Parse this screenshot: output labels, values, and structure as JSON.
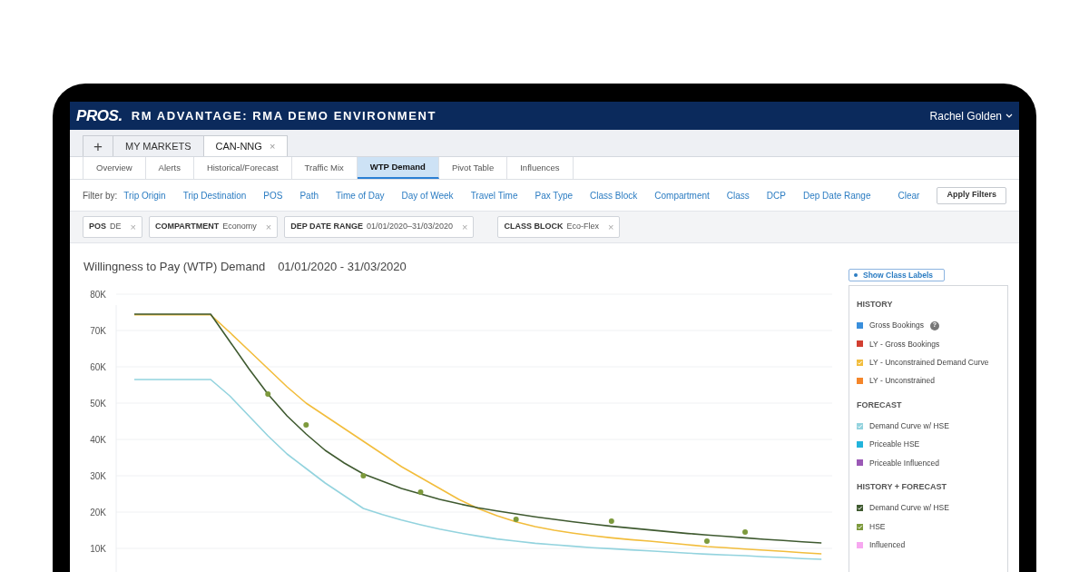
{
  "header": {
    "logo": "PROS.",
    "title": "RM ADVANTAGE: RMA DEMO ENVIRONMENT",
    "user": "Rachel Golden"
  },
  "workspace_tabs": {
    "add": "+",
    "tabs": [
      {
        "label": "MY MARKETS",
        "selected": false
      },
      {
        "label": "CAN-NNG",
        "selected": true,
        "close": "×"
      }
    ]
  },
  "view_tabs": [
    {
      "label": "Overview",
      "selected": false
    },
    {
      "label": "Alerts",
      "selected": false
    },
    {
      "label": "Historical/Forecast",
      "selected": false
    },
    {
      "label": "Traffic Mix",
      "selected": false
    },
    {
      "label": "WTP Demand",
      "selected": true
    },
    {
      "label": "Pivot Table",
      "selected": false
    },
    {
      "label": "Influences",
      "selected": false
    }
  ],
  "filter_bar": {
    "label": "Filter by:",
    "filters": [
      "Trip Origin",
      "Trip Destination",
      "POS",
      "Path",
      "Time of Day",
      "Day of Week",
      "Travel Time",
      "Pax Type",
      "Class Block",
      "Compartment",
      "Class",
      "DCP",
      "Dep Date Range"
    ],
    "clear": "Clear",
    "apply": "Apply Filters"
  },
  "active_filters": [
    {
      "name": "POS",
      "value": "DE",
      "remove": "×"
    },
    {
      "name": "COMPARTMENT",
      "value": "Economy",
      "remove": "×"
    },
    {
      "name": "DEP DATE RANGE",
      "value": "01/01/2020–31/03/2020",
      "remove": "×"
    },
    {
      "name": "CLASS BLOCK",
      "value": "Eco-Flex",
      "remove": "×"
    }
  ],
  "chart": {
    "title": "Willingness to Pay (WTP) Demand",
    "date_range": "01/01/2020 - 31/03/2020",
    "show_class_labels": "Show Class Labels",
    "chart_data": {
      "type": "line",
      "categories": [
        null,
        null,
        null,
        null,
        null,
        null,
        null,
        null,
        null,
        null,
        null,
        null,
        null,
        null,
        null,
        null,
        null,
        null,
        null,
        null,
        null,
        null,
        null,
        null,
        null,
        null,
        null,
        null,
        null,
        null,
        null,
        null,
        null,
        null,
        null,
        null,
        null
      ],
      "ylim": [
        3500,
        80000
      ],
      "grid": true,
      "yticks": [
        {
          "value": 10000,
          "label": "10K"
        },
        {
          "value": 20000,
          "label": "20K"
        },
        {
          "value": 30000,
          "label": "30K"
        },
        {
          "value": 40000,
          "label": "40K"
        },
        {
          "value": 50000,
          "label": "50K"
        },
        {
          "value": 60000,
          "label": "60K"
        },
        {
          "value": 70000,
          "label": "70K"
        },
        {
          "value": 80000,
          "label": "80K"
        }
      ],
      "series": [
        {
          "color": "#f2bd3c",
          "values": [
            74300,
            74300,
            74300,
            74300,
            74300,
            69500,
            64500,
            59500,
            54500,
            50000,
            46500,
            43000,
            39500,
            36000,
            32500,
            29500,
            26500,
            23500,
            21000,
            19000,
            17300,
            16000,
            15000,
            14200,
            13500,
            12900,
            12400,
            12000,
            11500,
            11000,
            10500,
            10200,
            9800,
            9500,
            9200,
            8800,
            8500
          ]
        },
        {
          "color": "#93d3de",
          "values": [
            56500,
            56500,
            56500,
            56500,
            56500,
            52000,
            46500,
            41000,
            36000,
            32000,
            28000,
            24500,
            21000,
            19300,
            17800,
            16500,
            15300,
            14300,
            13400,
            12600,
            12000,
            11400,
            11000,
            10600,
            10200,
            9900,
            9600,
            9300,
            9000,
            8700,
            8400,
            8200,
            8000,
            7700,
            7500,
            7200,
            7000
          ]
        },
        {
          "color": "#3f5a30",
          "values": [
            74500,
            74500,
            74500,
            74500,
            74500,
            67000,
            59500,
            52500,
            46500,
            41500,
            37000,
            33500,
            30500,
            28500,
            26500,
            25000,
            23500,
            22300,
            21200,
            20300,
            19500,
            18700,
            18000,
            17300,
            16700,
            16100,
            15600,
            15100,
            14600,
            14100,
            13700,
            13300,
            12900,
            12500,
            12200,
            11800,
            11500
          ]
        },
        {
          "color": "#7d9a3c",
          "type": "scatter",
          "values": [
            null,
            null,
            null,
            null,
            null,
            null,
            null,
            52500,
            null,
            44000,
            null,
            null,
            30000,
            null,
            null,
            25500,
            null,
            null,
            null,
            null,
            18000,
            null,
            null,
            null,
            null,
            17500,
            null,
            null,
            null,
            null,
            12000,
            null,
            14500,
            null,
            null,
            null,
            null
          ]
        }
      ]
    }
  },
  "legend": [
    {
      "heading": "HISTORY",
      "items": [
        {
          "label": "Gross Bookings",
          "kind": "square",
          "color": "#3a8fdc",
          "help": "?"
        },
        {
          "label": "LY - Gross Bookings",
          "kind": "square",
          "color": "#d23f31"
        },
        {
          "label": "LY - Unconstrained Demand Curve",
          "kind": "check",
          "color": "#f2bd3c"
        },
        {
          "label": "LY - Unconstrained",
          "kind": "square",
          "color": "#f5862a"
        }
      ]
    },
    {
      "heading": "FORECAST",
      "items": [
        {
          "label": "Demand Curve w/ HSE",
          "kind": "check",
          "color": "#93d3de"
        },
        {
          "label": "Priceable HSE",
          "kind": "square",
          "color": "#22b4dc"
        },
        {
          "label": "Priceable Influenced",
          "kind": "square",
          "color": "#9b59b6"
        }
      ]
    },
    {
      "heading": "HISTORY + FORECAST",
      "items": [
        {
          "label": "Demand Curve w/ HSE",
          "kind": "check",
          "color": "#3f5a30"
        },
        {
          "label": "HSE",
          "kind": "check",
          "color": "#7d9a3c"
        },
        {
          "label": "Influenced",
          "kind": "square",
          "color": "#f7a8f0"
        }
      ]
    }
  ]
}
